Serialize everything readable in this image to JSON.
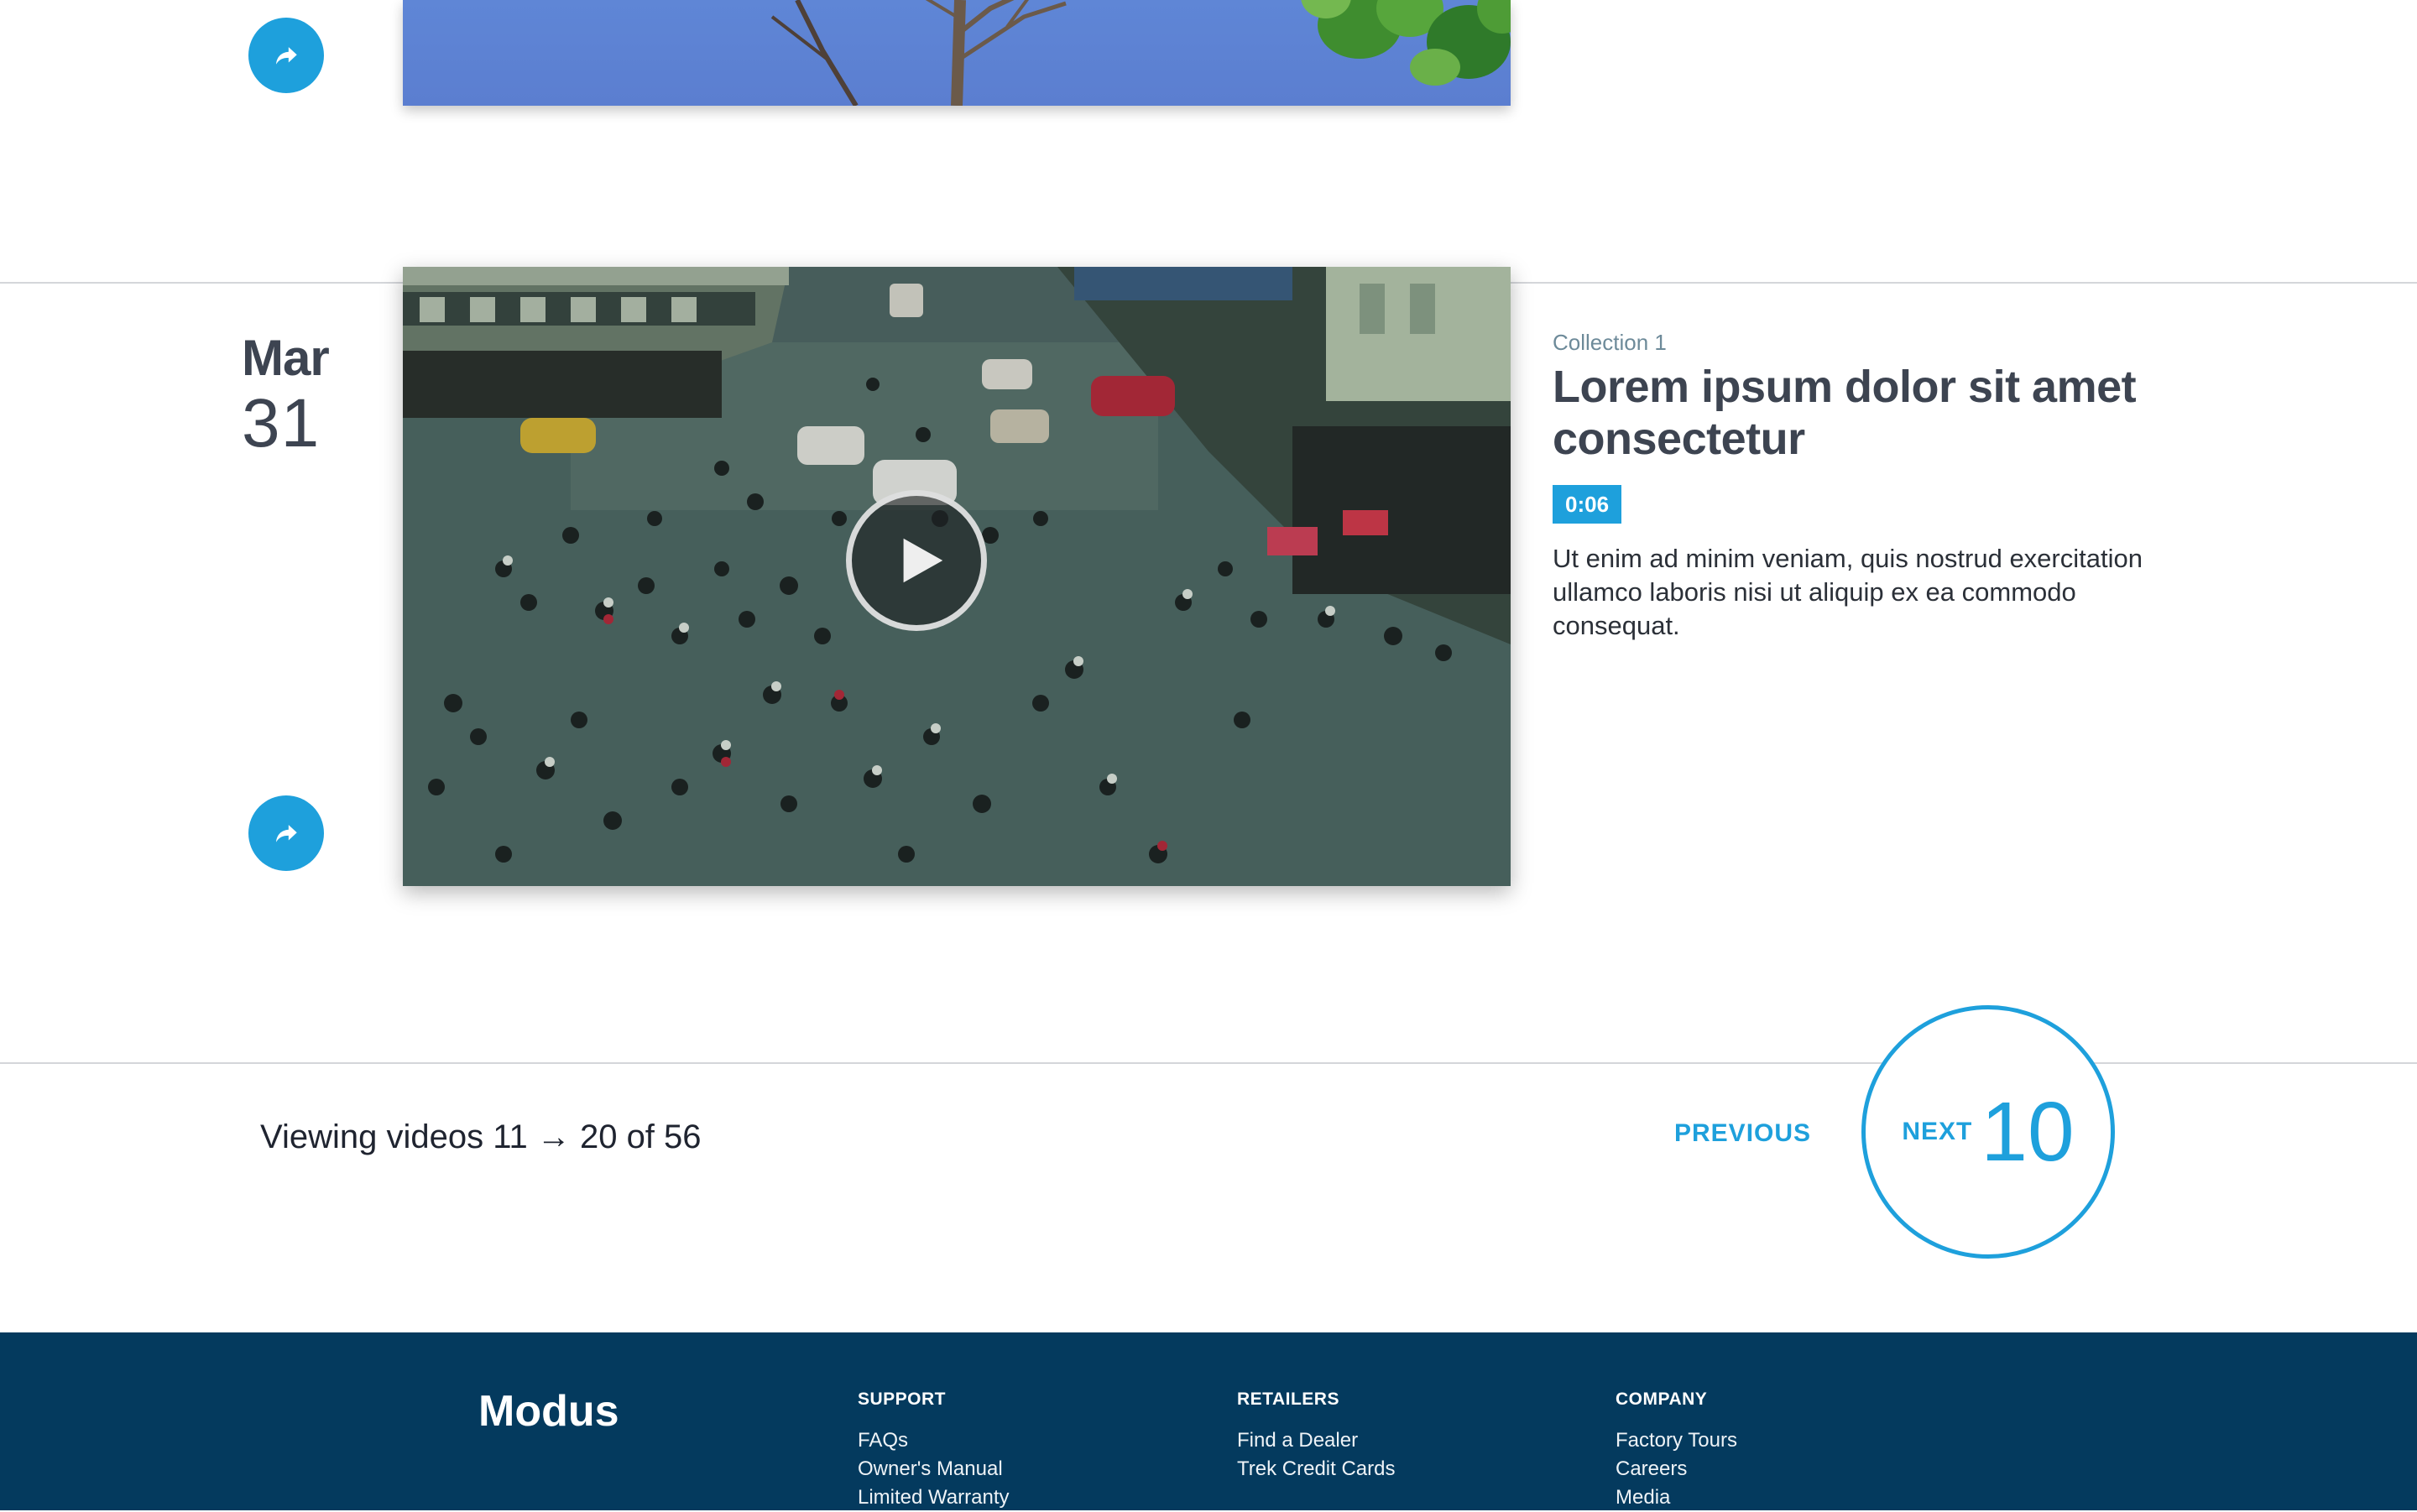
{
  "previous_entry": {
    "share_icon": "share-arrow-icon"
  },
  "entry": {
    "date": {
      "month": "Mar",
      "day": "31"
    },
    "collection": "Collection 1",
    "title": "Lorem ipsum dolor sit amet consectetur",
    "duration": "0:06",
    "description": "Ut enim ad minim veniam, quis nostrud exercitation ullamco laboris nisi ut aliquip ex ea commodo consequat.",
    "play_icon": "play-icon",
    "share_icon": "share-arrow-icon"
  },
  "pagination": {
    "viewing": "Viewing videos 11 → 20 of 56",
    "previous_label": "PREVIOUS",
    "next_label": "NEXT",
    "next_count": "10"
  },
  "footer": {
    "logo": "Modus",
    "columns": [
      {
        "heading": "SUPPORT",
        "links": [
          "FAQs",
          "Owner's Manual",
          "Limited Warranty"
        ]
      },
      {
        "heading": "RETAILERS",
        "links": [
          "Find a Dealer",
          "Trek Credit Cards"
        ]
      },
      {
        "heading": "COMPANY",
        "links": [
          "Factory Tours",
          "Careers",
          "Media"
        ]
      }
    ]
  },
  "colors": {
    "accent": "#1ea0dc",
    "footer_bg": "#043a5e",
    "heading_text": "#3d4451",
    "collection_text": "#6d8a99"
  }
}
